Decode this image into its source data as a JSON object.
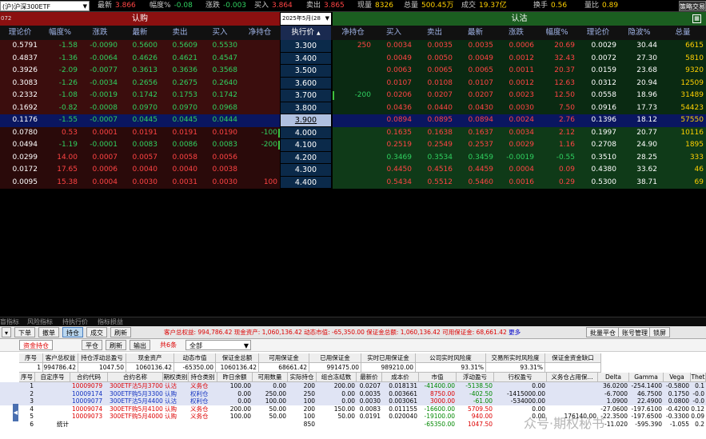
{
  "topbar": {
    "instrument": "(沪)沪深300ETF",
    "quotes": [
      {
        "label": "最新",
        "value": "3.866",
        "cls": "qr"
      },
      {
        "label": "幅度%",
        "value": "-0.08",
        "cls": "qg"
      },
      {
        "label": "涨跌",
        "value": "-0.003",
        "cls": "qg"
      },
      {
        "label": "买入",
        "value": "3.864",
        "cls": "qr"
      },
      {
        "label": "卖出",
        "value": "3.865",
        "cls": "qr"
      },
      {
        "label": "现量",
        "value": "8326",
        "cls": "qy"
      },
      {
        "label": "总量",
        "value": "500.45万",
        "cls": "qy"
      },
      {
        "label": "成交",
        "value": "19.37亿",
        "cls": "qy"
      },
      {
        "label": "换手",
        "value": "0.56",
        "cls": "qy"
      },
      {
        "label": "量比",
        "value": "0.89",
        "cls": "qy"
      }
    ],
    "help_label": "策略交易"
  },
  "header": {
    "left_tag": "072",
    "call_title": "认购",
    "expiry": "2025年5月(28",
    "put_title": "认沽"
  },
  "columns": {
    "call": [
      "理论价",
      "幅度%",
      "涨跌",
      "最新",
      "卖出",
      "买入",
      "净持仓"
    ],
    "strike": "执行价",
    "put": [
      "净持仓",
      "买入",
      "卖出",
      "最新",
      "涨跌",
      "幅度%",
      "理论价",
      "隐波%",
      "总量"
    ]
  },
  "rows": [
    {
      "call": [
        "0.5791",
        "-1.58",
        "-0.0090",
        "0.5600",
        "0.5609",
        "0.5530",
        ""
      ],
      "strike": "3.300",
      "put": [
        "250",
        "0.0034",
        "0.0035",
        "0.0035",
        "0.0006",
        "20.69",
        "0.0029",
        "30.44",
        "6615"
      ],
      "itm": true,
      "putmark": false,
      "callmark": false
    },
    {
      "call": [
        "0.4837",
        "-1.36",
        "-0.0064",
        "0.4626",
        "0.4621",
        "0.4547",
        ""
      ],
      "strike": "3.400",
      "put": [
        "",
        "0.0049",
        "0.0050",
        "0.0049",
        "0.0012",
        "32.43",
        "0.0072",
        "27.30",
        "5810"
      ],
      "itm": true
    },
    {
      "call": [
        "0.3926",
        "-2.09",
        "-0.0077",
        "0.3613",
        "0.3636",
        "0.3568",
        ""
      ],
      "strike": "3.500",
      "put": [
        "",
        "0.0063",
        "0.0065",
        "0.0065",
        "0.0011",
        "20.37",
        "0.0159",
        "23.68",
        "9320"
      ],
      "itm": true
    },
    {
      "call": [
        "0.3083",
        "-1.26",
        "-0.0034",
        "0.2656",
        "0.2675",
        "0.2640",
        ""
      ],
      "strike": "3.600",
      "put": [
        "",
        "0.0107",
        "0.0108",
        "0.0107",
        "0.0012",
        "12.63",
        "0.0312",
        "20.94",
        "12509"
      ],
      "itm": true
    },
    {
      "call": [
        "0.2332",
        "-1.08",
        "-0.0019",
        "0.1742",
        "0.1753",
        "0.1742",
        ""
      ],
      "strike": "3.700",
      "put": [
        "-200",
        "0.0206",
        "0.0207",
        "0.0207",
        "0.0023",
        "12.50",
        "0.0558",
        "18.96",
        "31489"
      ],
      "itm": true,
      "putmark": true
    },
    {
      "call": [
        "0.1692",
        "-0.82",
        "-0.0008",
        "0.0970",
        "0.0970",
        "0.0968",
        ""
      ],
      "strike": "3.800",
      "put": [
        "",
        "0.0436",
        "0.0440",
        "0.0430",
        "0.0030",
        "7.50",
        "0.0916",
        "17.73",
        "54423"
      ],
      "itm": true
    },
    {
      "call": [
        "0.1176",
        "-1.55",
        "-0.0007",
        "0.0445",
        "0.0445",
        "0.0444",
        ""
      ],
      "strike": "3.900",
      "put": [
        "",
        "0.0894",
        "0.0895",
        "0.0894",
        "0.0024",
        "2.76",
        "0.1396",
        "18.12",
        "57550"
      ],
      "sel": true
    },
    {
      "call": [
        "0.0780",
        "0.53",
        "0.0001",
        "0.0191",
        "0.0191",
        "0.0190",
        "-100"
      ],
      "strike": "4.000",
      "put": [
        "",
        "0.1635",
        "0.1638",
        "0.1637",
        "0.0034",
        "2.12",
        "0.1997",
        "20.77",
        "10116"
      ],
      "callmark": true
    },
    {
      "call": [
        "0.0494",
        "-1.19",
        "-0.0001",
        "0.0083",
        "0.0086",
        "0.0083",
        "-200"
      ],
      "strike": "4.100",
      "put": [
        "",
        "0.2519",
        "0.2549",
        "0.2537",
        "0.0029",
        "1.16",
        "0.2708",
        "24.90",
        "1895"
      ],
      "callmark": true
    },
    {
      "call": [
        "0.0299",
        "14.00",
        "0.0007",
        "0.0057",
        "0.0058",
        "0.0056",
        ""
      ],
      "strike": "4.200",
      "put": [
        "",
        "0.3469",
        "0.3534",
        "0.3459",
        "-0.0019",
        "-0.55",
        "0.3510",
        "28.25",
        "333"
      ]
    },
    {
      "call": [
        "0.0172",
        "17.65",
        "0.0006",
        "0.0040",
        "0.0040",
        "0.0038",
        ""
      ],
      "strike": "4.300",
      "put": [
        "",
        "0.4450",
        "0.4516",
        "0.4459",
        "0.0004",
        "0.09",
        "0.4380",
        "33.62",
        "46"
      ]
    },
    {
      "call": [
        "0.0095",
        "15.38",
        "0.0004",
        "0.0030",
        "0.0031",
        "0.0030",
        "100"
      ],
      "strike": "4.400",
      "put": [
        "",
        "0.5434",
        "0.5512",
        "0.5460",
        "0.0016",
        "0.29",
        "0.5300",
        "38.71",
        "69"
      ]
    }
  ],
  "midtabs": [
    "盲指标",
    "风险指标",
    "持执行价",
    "指标损益"
  ],
  "lower": {
    "tabs": [
      "下单",
      "撤单",
      "持仓",
      "成交",
      "刷新"
    ],
    "active_tab": "持仓",
    "acct_info": "客户总权益: 994,786.42  现金资产: 1,060,136.42  动态市值: -65,350.00  保证金总额: 1,060,136.42  可用保证金: 68,661.42",
    "more": "更多",
    "right_buttons": [
      "批量平仓",
      "账号管理",
      "锁屏"
    ],
    "sub_tabs": [
      "资金持仓",
      "平仓",
      "刷新",
      "输出",
      "共6条"
    ],
    "filter": "全部",
    "summary_headers": [
      "序号",
      "客户总权益",
      "持仓浮动总盈亏",
      "现金资产",
      "动态市值",
      "保证金总额",
      "可用保证金",
      "已用保证金",
      "实时已用保证金",
      "公司实时风险度",
      "交易所实时风险度",
      "保证金资金缺口"
    ],
    "summary_values": [
      "1",
      "994786.42",
      "1047.50",
      "1060136.42",
      "-65350.00",
      "1060136.42",
      "68661.42",
      "991475.00",
      "989210.00",
      "93.31%",
      "93.31%",
      ""
    ],
    "pos_headers": [
      "序号",
      "自定序号",
      "合约代码",
      "合约名称",
      "期权类别",
      "持仓类别",
      "昨日余额",
      "可用数量",
      "实际持仓",
      "组合冻结数",
      "最新价",
      "成本价",
      "市值",
      "浮动盈亏",
      "行权盈亏",
      "义务仓占用保...",
      "Delta",
      "Gamma",
      "Vega",
      "Thet"
    ],
    "positions": [
      [
        "1",
        "",
        "10009079",
        "300ETF沽5月3700",
        "认沽",
        "义务仓",
        "100.00",
        "0.00",
        "200",
        "200.00",
        "0.0207",
        "0.018131",
        "-41400.00",
        "-5138.50",
        "0.00",
        "",
        "36.0200",
        "-254.1400",
        "-0.5800",
        "0.1"
      ],
      [
        "2",
        "",
        "10009174",
        "300ETF购5月3300",
        "认购",
        "权利仓",
        "0.00",
        "250.00",
        "250",
        "0.00",
        "0.0035",
        "0.003661",
        "8750.00",
        "-402.50",
        "-1415000.00",
        "",
        "-6.7000",
        "46.7500",
        "0.1750",
        "-0.0"
      ],
      [
        "3",
        "",
        "10009077",
        "300ETF沽5月4400",
        "认沽",
        "权利仓",
        "0.00",
        "100.00",
        "100",
        "0.00",
        "0.0030",
        "0.003061",
        "3000.00",
        "-61.00",
        "-534000.00",
        "",
        "1.0900",
        "22.4900",
        "0.0800",
        "-0.0"
      ],
      [
        "4",
        "",
        "10009074",
        "300ETF购5月4100",
        "认购",
        "义务仓",
        "200.00",
        "50.00",
        "200",
        "150.00",
        "0.0083",
        "0.011155",
        "-16600.00",
        "5709.50",
        "0.00",
        "",
        "-27.0600",
        "-197.6100",
        "-0.4200",
        "0.12"
      ],
      [
        "5",
        "",
        "10009073",
        "300ETF购5月4000",
        "认购",
        "义务仓",
        "100.00",
        "50.00",
        "100",
        "50.00",
        "0.0191",
        "0.020040",
        "-19100.00",
        "940.00",
        "0.00",
        "176140.00",
        "-22.3500",
        "-197.6500",
        "-0.3300",
        "0.09"
      ],
      [
        "6",
        "统计",
        "",
        "",
        "",
        "",
        "",
        "",
        "850",
        "",
        "",
        "",
        "-65350.00",
        "1047.50",
        "",
        "",
        "-11.020",
        "-595.390",
        "-1.055",
        "0.2"
      ]
    ]
  },
  "watermark": "众号·期权秘书",
  "colors": {
    "call_band": "#8b1010",
    "put_band": "#1b5e20",
    "strike_bg": "#0b2a4a",
    "selected_row": "#0a1660"
  }
}
